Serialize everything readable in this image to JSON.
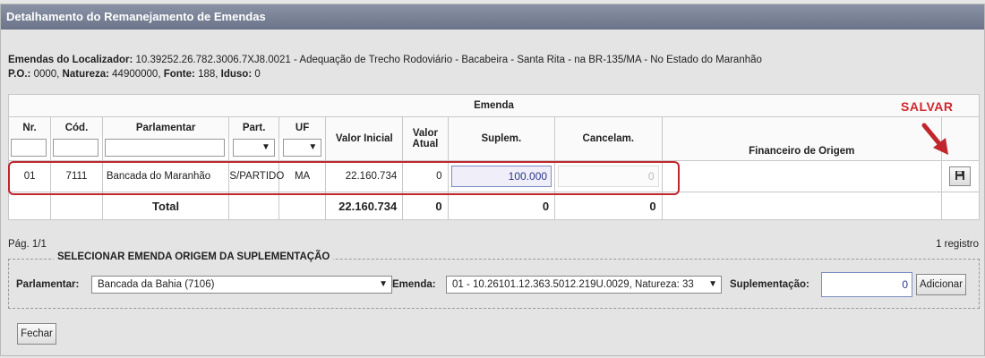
{
  "window": {
    "title": "Detalhamento do Remanejamento de Emendas"
  },
  "info": {
    "localizador_label": "Emendas do Localizador:",
    "localizador_value": "10.39252.26.782.3006.7XJ8.0021 - Adequação de Trecho Rodoviário - Bacabeira - Santa Rita - na BR-135/MA - No Estado do Maranhão",
    "po_label": "P.O.:",
    "po_value": "0000,",
    "natureza_label": "Natureza:",
    "natureza_value": "44900000,",
    "fonte_label": "Fonte:",
    "fonte_value": "188,",
    "iduso_label": "Iduso:",
    "iduso_value": "0"
  },
  "table": {
    "group_header": "Emenda",
    "columns": {
      "nr": "Nr.",
      "cod": "Cód.",
      "parlamentar": "Parlamentar",
      "part": "Part.",
      "uf": "UF",
      "valor_inicial": "Valor Inicial",
      "valor_atual": "Valor Atual",
      "suplem": "Suplem.",
      "cancelam": "Cancelam.",
      "financeiro": "Financeiro de Origem"
    },
    "row": {
      "nr": "01",
      "cod": "7111",
      "parlamentar": "Bancada do Maranhão",
      "part": "S/PARTIDO",
      "uf": "MA",
      "valor_inicial": "22.160.734",
      "valor_atual": "0",
      "suplem": "100.000",
      "cancelam": "0",
      "save_icon": "save-icon"
    },
    "total": {
      "label": "Total",
      "valor_inicial": "22.160.734",
      "valor_atual": "0",
      "suplem": "0",
      "cancelam": "0"
    }
  },
  "annotation": {
    "salvar": "SALVAR",
    "color": "#c0262c"
  },
  "pagination": {
    "page": "Pág. 1/1",
    "count": "1 registro"
  },
  "selection": {
    "legend": "SELECIONAR EMENDA ORIGEM DA SUPLEMENTAÇÃO",
    "parlamentar_label": "Parlamentar:",
    "parlamentar_value": "Bancada da Bahia (7106)",
    "emenda_label": "Emenda:",
    "emenda_value": "01 - 10.26101.12.363.5012.219U.0029, Natureza: 33",
    "suplementacao_label": "Suplementação:",
    "suplementacao_value": "0",
    "add_button": "Adicionar"
  },
  "footer": {
    "close_button": "Fechar"
  }
}
